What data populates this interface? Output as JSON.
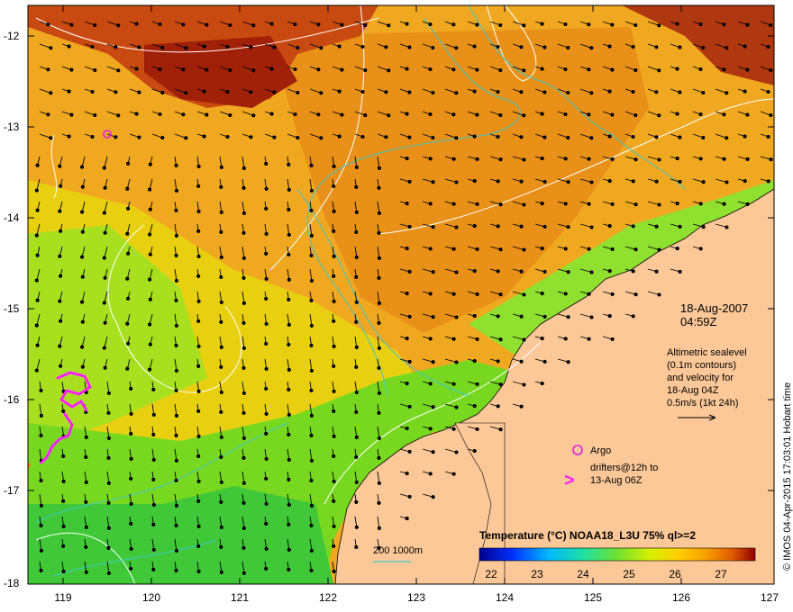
{
  "map": {
    "lat_labels": [
      "-12",
      "-13",
      "-14",
      "-15",
      "-16",
      "-17",
      "-18"
    ],
    "lon_labels": [
      "119",
      "120",
      "121",
      "122",
      "123",
      "124",
      "125",
      "126",
      "127"
    ],
    "date": "18-Aug-2007",
    "time": "04:59Z",
    "altimetry_lines": [
      "Altimetric sealevel",
      "(0.1m contours)",
      "and velocity for",
      "18-Aug 04Z",
      "0.5m/s (1kt 24h)"
    ],
    "argo_label": "Argo",
    "drifters_lines": [
      "drifters@12h to",
      "13-Aug 06Z"
    ],
    "drifters_symbol": ">",
    "isobath_label": "200  1000m",
    "colorbar_title": "Temperature (°C) NOAA18_L3U 75% ql>=2",
    "colorbar_ticks": [
      "22",
      "23",
      "24",
      "25",
      "26",
      "27"
    ],
    "credit": "© IMOS 04-Apr-2015 17:03:01 Hobart time",
    "colors": {
      "land": "#fcc898",
      "contour": "#ffffff",
      "isobath": "#3ec8c8",
      "argo": "#e020e0",
      "drifter": "#ff20ff"
    }
  }
}
